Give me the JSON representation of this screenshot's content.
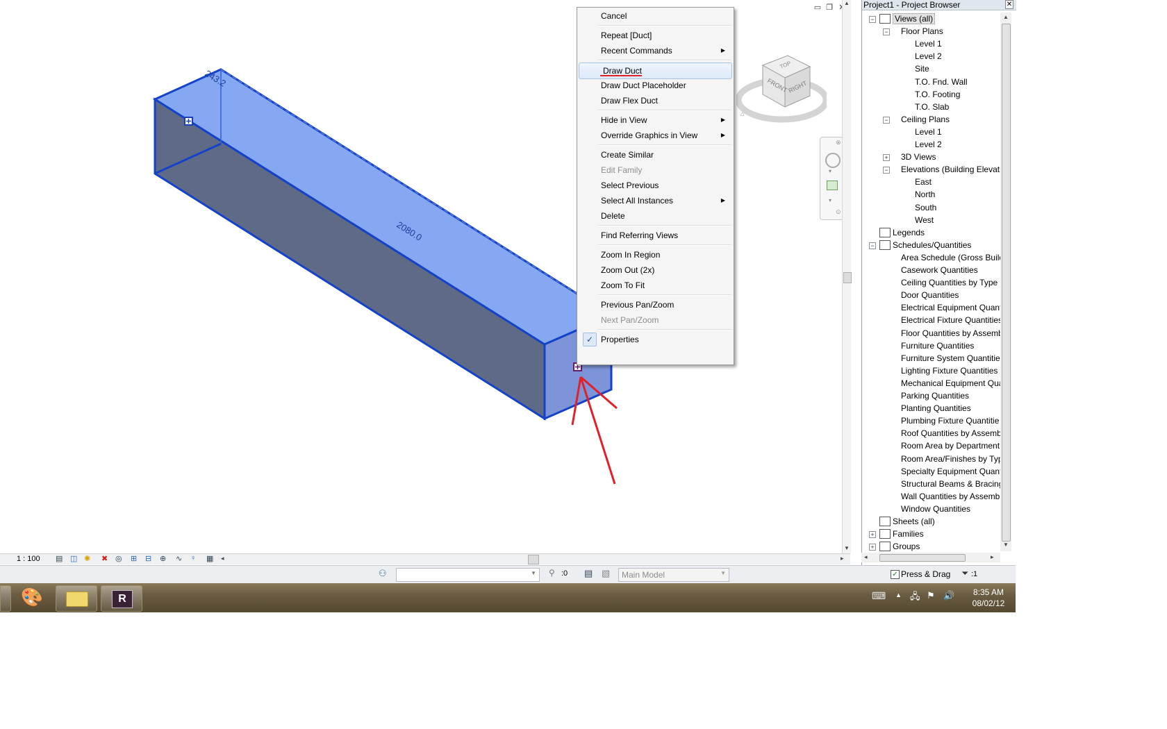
{
  "viewport": {
    "dimension_top": "243.2",
    "dimension_length": "2080.0",
    "scale": "1 : 100"
  },
  "viewcube": {
    "top_label": "TOP",
    "front_label": "FRONT",
    "right_label": "RIGHT"
  },
  "context_menu": {
    "items": [
      {
        "label": "Cancel",
        "enabled": true
      },
      {
        "label": "Repeat [Duct]",
        "enabled": true
      },
      {
        "label": "Recent Commands",
        "enabled": true,
        "submenu": true
      },
      {
        "label": "Draw Duct",
        "enabled": true,
        "highlighted": true
      },
      {
        "label": "Draw Duct Placeholder",
        "enabled": true
      },
      {
        "label": "Draw Flex Duct",
        "enabled": true
      },
      {
        "label": "Hide in View",
        "enabled": true,
        "submenu": true
      },
      {
        "label": "Override Graphics in View",
        "enabled": true,
        "submenu": true
      },
      {
        "label": "Create Similar",
        "enabled": true
      },
      {
        "label": "Edit Family",
        "enabled": false
      },
      {
        "label": "Select Previous",
        "enabled": true
      },
      {
        "label": "Select All Instances",
        "enabled": true,
        "submenu": true
      },
      {
        "label": "Delete",
        "enabled": true
      },
      {
        "label": "Find Referring Views",
        "enabled": true
      },
      {
        "label": "Zoom In Region",
        "enabled": true
      },
      {
        "label": "Zoom Out (2x)",
        "enabled": true
      },
      {
        "label": "Zoom To Fit",
        "enabled": true
      },
      {
        "label": "Previous Pan/Zoom",
        "enabled": true
      },
      {
        "label": "Next Pan/Zoom",
        "enabled": false
      },
      {
        "label": "Properties",
        "enabled": true,
        "checked": true
      }
    ]
  },
  "project_browser": {
    "title": "Project1 - Project Browser",
    "tree": [
      {
        "label": "Views (all)",
        "level": 0,
        "expander": "minus",
        "icon": "views-icon",
        "selected": true
      },
      {
        "label": "Floor Plans",
        "level": 1,
        "expander": "minus"
      },
      {
        "label": "Level 1",
        "level": 2
      },
      {
        "label": "Level 2",
        "level": 2
      },
      {
        "label": "Site",
        "level": 2
      },
      {
        "label": "T.O. Fnd. Wall",
        "level": 2
      },
      {
        "label": "T.O. Footing",
        "level": 2
      },
      {
        "label": "T.O. Slab",
        "level": 2
      },
      {
        "label": "Ceiling Plans",
        "level": 1,
        "expander": "minus"
      },
      {
        "label": "Level 1",
        "level": 2
      },
      {
        "label": "Level 2",
        "level": 2
      },
      {
        "label": "3D Views",
        "level": 1,
        "expander": "plus"
      },
      {
        "label": "Elevations (Building Elevatio",
        "level": 1,
        "expander": "minus"
      },
      {
        "label": "East",
        "level": 2
      },
      {
        "label": "North",
        "level": 2
      },
      {
        "label": "South",
        "level": 2
      },
      {
        "label": "West",
        "level": 2
      },
      {
        "label": "Legends",
        "level": 0,
        "icon": "legends-icon"
      },
      {
        "label": "Schedules/Quantities",
        "level": 0,
        "expander": "minus",
        "icon": "schedules-icon"
      },
      {
        "label": "Area Schedule (Gross Buildir",
        "level": 1
      },
      {
        "label": "Casework Quantities",
        "level": 1
      },
      {
        "label": "Ceiling Quantities by Type",
        "level": 1
      },
      {
        "label": "Door Quantities",
        "level": 1
      },
      {
        "label": "Electrical Equipment Quantit",
        "level": 1
      },
      {
        "label": "Electrical Fixture Quantities",
        "level": 1
      },
      {
        "label": "Floor Quantities by Assembl",
        "level": 1
      },
      {
        "label": "Furniture Quantities",
        "level": 1
      },
      {
        "label": "Furniture System Quantitie:",
        "level": 1
      },
      {
        "label": "Lighting Fixture Quantities",
        "level": 1
      },
      {
        "label": "Mechanical Equipment Quar",
        "level": 1
      },
      {
        "label": "Parking Quantities",
        "level": 1
      },
      {
        "label": "Planting Quantities",
        "level": 1
      },
      {
        "label": "Plumbing Fixture Quantitie",
        "level": 1
      },
      {
        "label": "Roof Quantities by Assembl",
        "level": 1
      },
      {
        "label": "Room Area by Department",
        "level": 1
      },
      {
        "label": "Room Area/Finishes by Typ",
        "level": 1
      },
      {
        "label": "Specialty Equipment Quantit",
        "level": 1
      },
      {
        "label": "Structural Beams & Bracing",
        "level": 1
      },
      {
        "label": "Wall Quantities by Assembl",
        "level": 1
      },
      {
        "label": "Window Quantities",
        "level": 1
      },
      {
        "label": "Sheets (all)",
        "level": 0,
        "icon": "sheets-icon"
      },
      {
        "label": "Families",
        "level": 0,
        "expander": "plus",
        "icon": "families-icon"
      },
      {
        "label": "Groups",
        "level": 0,
        "expander": "plus",
        "icon": "groups-icon"
      }
    ]
  },
  "status_bar": {
    "count": ":0",
    "model_dropdown": "Main Model",
    "press_drag": "Press & Drag",
    "filter_count": ":1"
  },
  "taskbar": {
    "time": "8:35 AM",
    "date": "08/02/12"
  }
}
